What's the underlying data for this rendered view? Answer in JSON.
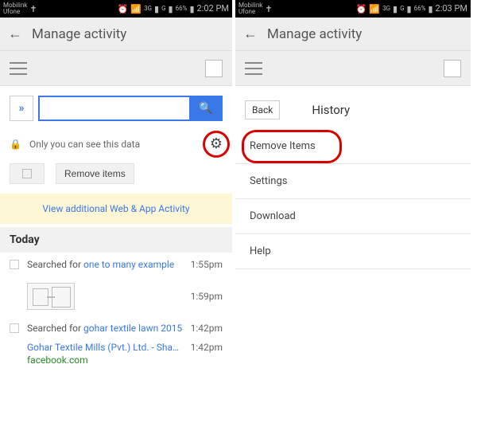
{
  "left": {
    "status": {
      "carrier_line1": "Mobilink",
      "carrier_line2": "Ufone",
      "signal_3g": "3G",
      "signal_g": "G",
      "battery": "66%",
      "time": "2:02 PM"
    },
    "header": {
      "title": "Manage activity"
    },
    "search": {
      "placeholder": ""
    },
    "privacy_text": "Only you can see this data",
    "remove_label": "Remove items",
    "banner_text": "View additional Web & App Activity",
    "today_label": "Today",
    "items": [
      {
        "prefix": "Searched for ",
        "link": "one to many example",
        "time": "1:55pm"
      },
      {
        "thumb": true,
        "time": "1:59pm"
      },
      {
        "prefix": "Searched for ",
        "link": "gohar textile lawn 2015",
        "time": "1:42pm"
      },
      {
        "blue": "Gohar Textile Mills (Pvt.) Ltd. - Shah...",
        "time": "1:42pm"
      },
      {
        "green": "facebook.com"
      }
    ]
  },
  "right": {
    "status": {
      "carrier_line1": "Mobilink",
      "carrier_line2": "Ufone",
      "signal_3g": "3G",
      "signal_g": "G",
      "battery": "66%",
      "time": "2:03 PM"
    },
    "header": {
      "title": "Manage activity"
    },
    "back_label": "Back",
    "history_title": "History",
    "menu": [
      {
        "label": "Remove Items",
        "highlight": true
      },
      {
        "label": "Settings"
      },
      {
        "label": "Download"
      },
      {
        "label": "Help"
      }
    ]
  }
}
